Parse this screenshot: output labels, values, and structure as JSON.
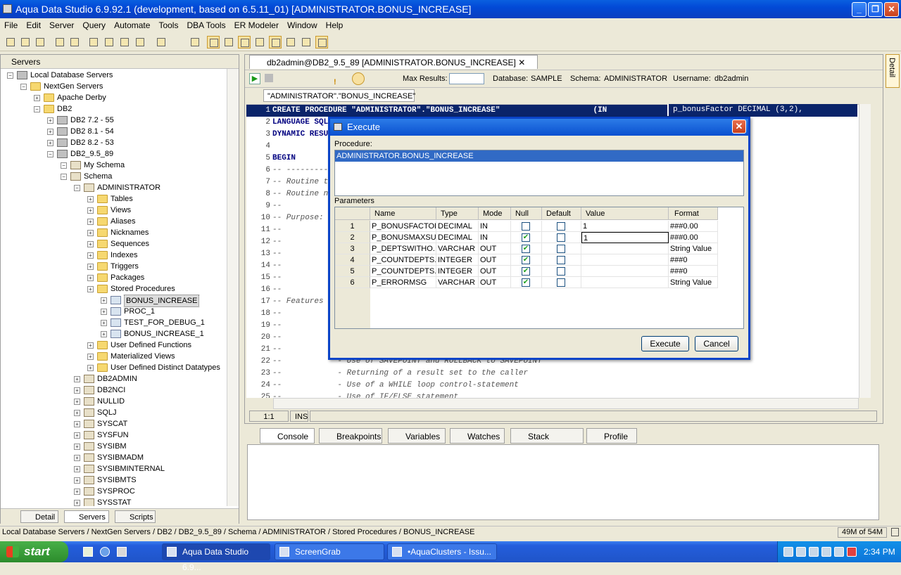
{
  "window": {
    "title": "Aqua Data Studio 6.9.92.1 (development, based on 6.5.11_01) [ADMINISTRATOR.BONUS_INCREASE]"
  },
  "menu": [
    "File",
    "Edit",
    "Server",
    "Query",
    "Automate",
    "Tools",
    "DBA Tools",
    "ER Modeler",
    "Window",
    "Help"
  ],
  "left_panel": {
    "title": "Servers",
    "tree": [
      {
        "label": "Local Database Servers",
        "level": 0,
        "icon": "server-group-icon"
      },
      {
        "label": "NextGen Servers",
        "level": 1,
        "icon": "folder-icon"
      },
      {
        "label": "Apache Derby",
        "level": 2,
        "icon": "folder-icon"
      },
      {
        "label": "DB2",
        "level": 2,
        "icon": "folder-icon"
      },
      {
        "label": "DB2 7.2 - 55",
        "level": 3,
        "icon": "database-icon"
      },
      {
        "label": "DB2 8.1 - 54",
        "level": 3,
        "icon": "database-icon"
      },
      {
        "label": "DB2 8.2 - 53",
        "level": 3,
        "icon": "database-icon"
      },
      {
        "label": "DB2_9.5_89",
        "level": 3,
        "icon": "database-icon"
      },
      {
        "label": "My Schema",
        "level": 4,
        "icon": "schema-icon"
      },
      {
        "label": "Schema",
        "level": 4,
        "icon": "schema-icon"
      },
      {
        "label": "ADMINISTRATOR",
        "level": 5,
        "icon": "schema-icon"
      },
      {
        "label": "Tables",
        "level": 6,
        "icon": "folder-icon"
      },
      {
        "label": "Views",
        "level": 6,
        "icon": "folder-icon"
      },
      {
        "label": "Aliases",
        "level": 6,
        "icon": "folder-icon"
      },
      {
        "label": "Nicknames",
        "level": 6,
        "icon": "folder-icon"
      },
      {
        "label": "Sequences",
        "level": 6,
        "icon": "folder-icon"
      },
      {
        "label": "Indexes",
        "level": 6,
        "icon": "folder-icon"
      },
      {
        "label": "Triggers",
        "level": 6,
        "icon": "folder-icon"
      },
      {
        "label": "Packages",
        "level": 6,
        "icon": "folder-icon"
      },
      {
        "label": "Stored Procedures",
        "level": 6,
        "icon": "folder-icon"
      },
      {
        "label": "BONUS_INCREASE",
        "level": 7,
        "icon": "procedure-icon",
        "selected": true
      },
      {
        "label": "PROC_1",
        "level": 7,
        "icon": "procedure-icon"
      },
      {
        "label": "TEST_FOR_DEBUG_1",
        "level": 7,
        "icon": "procedure-icon"
      },
      {
        "label": "BONUS_INCREASE_1",
        "level": 7,
        "icon": "procedure-icon"
      },
      {
        "label": "User Defined Functions",
        "level": 6,
        "icon": "folder-icon"
      },
      {
        "label": "Materialized Views",
        "level": 6,
        "icon": "folder-icon"
      },
      {
        "label": "User Defined Distinct Datatypes",
        "level": 6,
        "icon": "folder-icon"
      },
      {
        "label": "DB2ADMIN",
        "level": 5,
        "icon": "schema-icon"
      },
      {
        "label": "DB2NCI",
        "level": 5,
        "icon": "schema-icon"
      },
      {
        "label": "NULLID",
        "level": 5,
        "icon": "schema-icon"
      },
      {
        "label": "SQLJ",
        "level": 5,
        "icon": "schema-icon"
      },
      {
        "label": "SYSCAT",
        "level": 5,
        "icon": "schema-icon"
      },
      {
        "label": "SYSFUN",
        "level": 5,
        "icon": "schema-icon"
      },
      {
        "label": "SYSIBM",
        "level": 5,
        "icon": "schema-icon"
      },
      {
        "label": "SYSIBMADM",
        "level": 5,
        "icon": "schema-icon"
      },
      {
        "label": "SYSIBMINTERNAL",
        "level": 5,
        "icon": "schema-icon"
      },
      {
        "label": "SYSIBMTS",
        "level": 5,
        "icon": "schema-icon"
      },
      {
        "label": "SYSPROC",
        "level": 5,
        "icon": "schema-icon"
      },
      {
        "label": "SYSSTAT",
        "level": 5,
        "icon": "schema-icon"
      }
    ],
    "tabs": [
      "Detail",
      "Servers",
      "Scripts"
    ]
  },
  "editor": {
    "doc_tab": "db2admin@DB2_9.5_89 [ADMINISTRATOR.BONUS_INCREASE]",
    "max_results_label": "Max Results:",
    "max_results_value": "",
    "database_label": "Database:",
    "database": "SAMPLE",
    "schema_label": "Schema:",
    "schema": "ADMINISTRATOR",
    "username_label": "Username:",
    "username": "db2admin",
    "sub_tab": "\"ADMINISTRATOR\".\"BONUS_INCREASE\"",
    "line1_right": "p_bonusFactor DECIMAL (3,2),",
    "code_lines": [
      {
        "n": "1",
        "text": "CREATE PROCEDURE \"ADMINISTRATOR\".\"BONUS_INCREASE\"                    (IN"
      },
      {
        "n": "2",
        "text": "LANGUAGE SQL"
      },
      {
        "n": "3",
        "text": "DYNAMIC RESULT SETS 1"
      },
      {
        "n": "4",
        "text": ""
      },
      {
        "n": "5",
        "text": "BEGIN"
      },
      {
        "n": "6",
        "text": "-- ---------------------------"
      },
      {
        "n": "7",
        "text": "-- Routine type:  SQL stored procedure"
      },
      {
        "n": "8",
        "text": "-- Routine name:  bonus_increase"
      },
      {
        "n": "9",
        "text": "--"
      },
      {
        "n": "10",
        "text": "-- Purpose:"
      },
      {
        "n": "11",
        "text": "--"
      },
      {
        "n": "12",
        "text": "--"
      },
      {
        "n": "13",
        "text": "--"
      },
      {
        "n": "14",
        "text": "--"
      },
      {
        "n": "15",
        "text": "--"
      },
      {
        "n": "16",
        "text": "--"
      },
      {
        "n": "17",
        "text": "-- Features"
      },
      {
        "n": "18",
        "text": "--"
      },
      {
        "n": "19",
        "text": "--"
      },
      {
        "n": "20",
        "text": "--"
      },
      {
        "n": "21",
        "text": "--"
      },
      {
        "n": "22",
        "text": "--            - Use of SAVEPOINT and ROLLBACK to SAVEPOINT"
      },
      {
        "n": "23",
        "text": "--            - Returning of a result set to the caller"
      },
      {
        "n": "24",
        "text": "--            - Use of a WHILE loop control-statement"
      },
      {
        "n": "25",
        "text": "--            - Use of IF/ELSE statement"
      }
    ],
    "cursor_pos": "1:1",
    "insert_mode": "INS"
  },
  "side_tab": "Detail",
  "bottom_tabs": [
    "Console",
    "Breakpoints",
    "Variables",
    "Watches",
    "Stack Frames",
    "Profile"
  ],
  "dialog": {
    "title": "Execute",
    "procedure_label": "Procedure:",
    "procedure": "ADMINISTRATOR.BONUS_INCREASE",
    "parameters_label": "Parameters",
    "columns": [
      "Name",
      "Type",
      "Mode",
      "Null",
      "Default",
      "Value",
      "Format"
    ],
    "rows": [
      {
        "n": "1",
        "name": "P_BONUSFACTOR",
        "type": "DECIMAL",
        "mode": "IN",
        "null": false,
        "default": false,
        "value": "1",
        "format": "###0.00"
      },
      {
        "n": "2",
        "name": "P_BONUSMAXSU...",
        "type": "DECIMAL",
        "mode": "IN",
        "null": true,
        "default": false,
        "value": "1",
        "format": "###0.00"
      },
      {
        "n": "3",
        "name": "P_DEPTSWITHO...",
        "type": "VARCHAR",
        "mode": "OUT",
        "null": true,
        "default": false,
        "value": "",
        "format": "String Value"
      },
      {
        "n": "4",
        "name": "P_COUNTDEPTS...",
        "type": "INTEGER",
        "mode": "OUT",
        "null": true,
        "default": false,
        "value": "",
        "format": "###0"
      },
      {
        "n": "5",
        "name": "P_COUNTDEPTS...",
        "type": "INTEGER",
        "mode": "OUT",
        "null": true,
        "default": false,
        "value": "",
        "format": "###0"
      },
      {
        "n": "6",
        "name": "P_ERRORMSG",
        "type": "VARCHAR",
        "mode": "OUT",
        "null": true,
        "default": false,
        "value": "",
        "format": "String Value"
      }
    ],
    "execute_label": "Execute",
    "cancel_label": "Cancel"
  },
  "status": {
    "path": "Local Database Servers / NextGen Servers / DB2 / DB2_9.5_89 / Schema / ADMINISTRATOR / Stored Procedures / BONUS_INCREASE",
    "memory": "49M of 54M"
  },
  "taskbar": {
    "start": "start",
    "tasks": [
      "Aqua Data Studio 6.9...",
      "ScreenGrab",
      "•AquaClusters - Issu..."
    ],
    "clock": "2:34 PM"
  },
  "colors": {
    "selection": "#316ac5",
    "title_blue": "#0a50d0",
    "checkmark": "#21a121"
  }
}
